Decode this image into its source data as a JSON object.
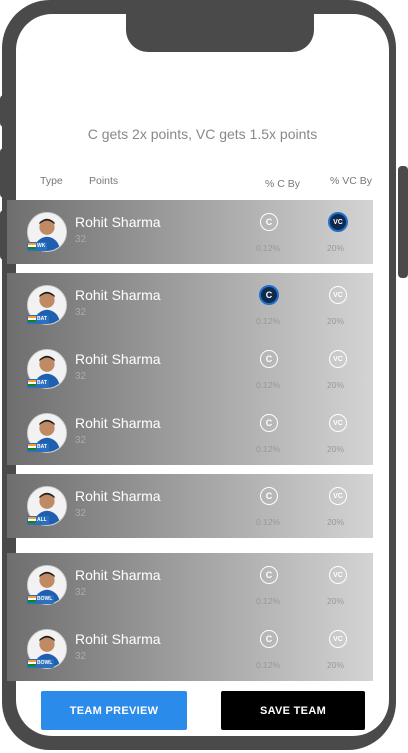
{
  "hint": "C gets 2x points, VC gets 1.5x points",
  "columns": {
    "type": "Type",
    "points": "Points",
    "c_by": "% C By",
    "vc_by": "% VC By"
  },
  "badges": {
    "c": "C",
    "vc": "VC"
  },
  "players": [
    {
      "name": "Rohit Sharma",
      "points": "32",
      "role": "WK",
      "c_pct": "0.12%",
      "vc_pct": "20%",
      "selected": "vc"
    },
    {
      "name": "Rohit Sharma",
      "points": "32",
      "role": "BAT",
      "c_pct": "0.12%",
      "vc_pct": "20%",
      "selected": "c"
    },
    {
      "name": "Rohit Sharma",
      "points": "32",
      "role": "BAT",
      "c_pct": "0.12%",
      "vc_pct": "20%",
      "selected": ""
    },
    {
      "name": "Rohit Sharma",
      "points": "32",
      "role": "BAT",
      "c_pct": "0.12%",
      "vc_pct": "20%",
      "selected": ""
    },
    {
      "name": "Rohit Sharma",
      "points": "32",
      "role": "ALL",
      "c_pct": "0.12%",
      "vc_pct": "20%",
      "selected": ""
    },
    {
      "name": "Rohit Sharma",
      "points": "32",
      "role": "BOWL",
      "c_pct": "0.12%",
      "vc_pct": "20%",
      "selected": ""
    },
    {
      "name": "Rohit Sharma",
      "points": "32",
      "role": "BOWL",
      "c_pct": "0.12%",
      "vc_pct": "20%",
      "selected": ""
    }
  ],
  "buttons": {
    "preview": "TEAM PREVIEW",
    "save": "SAVE TEAM"
  },
  "colors": {
    "preview": "#2a8bea",
    "save": "#000000",
    "active_badge": "#0f2a4a"
  }
}
